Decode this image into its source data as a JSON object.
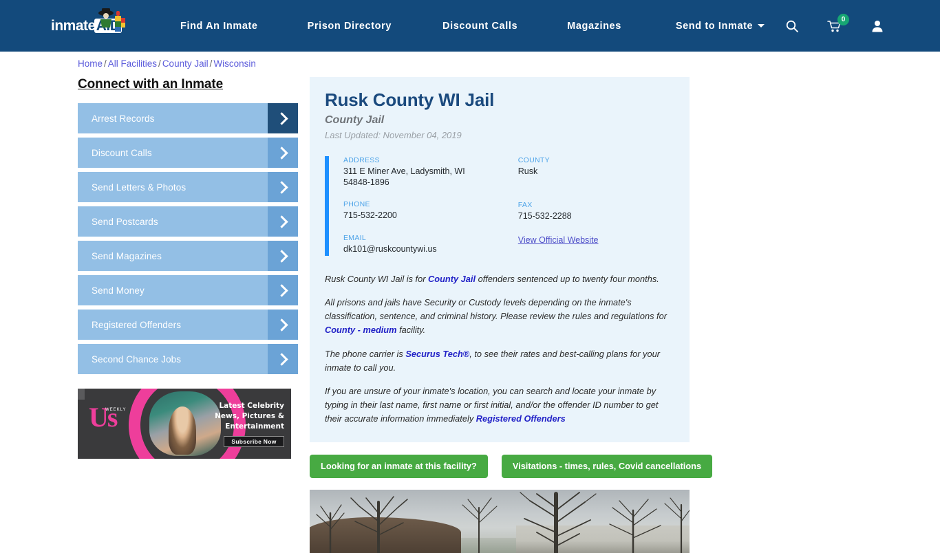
{
  "brand": {
    "logo_text_1": "inmate",
    "logo_text_2": "AID",
    "logo_icon": "inmate-character-logo"
  },
  "nav": {
    "items": [
      {
        "label": "Find An Inmate",
        "has_dropdown": false
      },
      {
        "label": "Prison Directory",
        "has_dropdown": false
      },
      {
        "label": "Discount Calls",
        "has_dropdown": false
      },
      {
        "label": "Magazines",
        "has_dropdown": false
      },
      {
        "label": "Send to Inmate",
        "has_dropdown": true
      }
    ],
    "icons": {
      "search": "search-icon",
      "cart": "cart-icon",
      "cart_count": "0",
      "account": "user-account-icon"
    },
    "background_color": "#134A7C",
    "badge_color": "#17A673"
  },
  "breadcrumb": {
    "items": [
      "Home",
      "All Facilities",
      "County Jail",
      "Wisconsin"
    ],
    "separator": "/",
    "link_color": "#5B5BDB"
  },
  "sidebar": {
    "title": "Connect with an Inmate",
    "items": [
      {
        "label": "Arrest Records",
        "active": true
      },
      {
        "label": "Discount Calls",
        "active": false
      },
      {
        "label": "Send Letters & Photos",
        "active": false
      },
      {
        "label": "Send Postcards",
        "active": false
      },
      {
        "label": "Send Magazines",
        "active": false
      },
      {
        "label": "Send Money",
        "active": false
      },
      {
        "label": "Registered Offenders",
        "active": false
      },
      {
        "label": "Second Chance Jobs",
        "active": false
      }
    ],
    "button_color": "#93BFE5",
    "arrow_color": "#6BA3D6",
    "arrow_active_color": "#1F4E79"
  },
  "ad": {
    "brand": "Us",
    "brand_sub": "WEEKLY",
    "headline": "Latest Celebrity News, Pictures & Entertainment",
    "cta": "Subscribe Now",
    "accent_color": "#EE3E9B"
  },
  "facility": {
    "name": "Rusk County WI Jail",
    "type": "County Jail",
    "last_updated": "Last Updated: November 04, 2019",
    "contact": {
      "address_label": "ADDRESS",
      "address_value": "311 E Miner Ave, Ladysmith, WI 54848-1896",
      "county_label": "COUNTY",
      "county_value": "Rusk",
      "phone_label": "PHONE",
      "phone_value": "715-532-2200",
      "fax_label": "FAX",
      "fax_value": "715-532-2288",
      "email_label": "EMAIL",
      "email_value": "dk101@ruskcountywi.us",
      "website_link": "View Official Website"
    },
    "description": [
      {
        "parts": [
          {
            "text": "Rusk County WI Jail is for ",
            "bold": false
          },
          {
            "text": "County Jail",
            "bold": true
          },
          {
            "text": " offenders sentenced up to twenty four months.",
            "bold": false
          }
        ]
      },
      {
        "parts": [
          {
            "text": "All prisons and jails have Security or Custody levels depending on the inmate's classification, sentence, and criminal history. Please review the rules and regulations for ",
            "bold": false
          },
          {
            "text": "County - medium",
            "bold": true
          },
          {
            "text": " facility.",
            "bold": false
          }
        ]
      },
      {
        "parts": [
          {
            "text": "The phone carrier is ",
            "bold": false
          },
          {
            "text": "Securus Tech®",
            "bold": true
          },
          {
            "text": ", to see their rates and best-calling plans for your inmate to call you.",
            "bold": false
          }
        ]
      },
      {
        "parts": [
          {
            "text": "If you are unsure of your inmate's location, you can search and locate your inmate by typing in their last name, first name or first initial, and/or the offender ID number to get their accurate information immediately ",
            "bold": false
          },
          {
            "text": "Registered Offenders",
            "bold": true
          }
        ]
      }
    ],
    "buttons": [
      {
        "label": "Looking for an inmate at this facility?"
      },
      {
        "label": "Visitations - times, rules, Covid cancellations"
      }
    ],
    "button_color": "#47AA42",
    "card_background": "#EAF4FB",
    "accent_bar_color": "#1E90FF",
    "photo_alt": "facility-exterior-photo"
  }
}
